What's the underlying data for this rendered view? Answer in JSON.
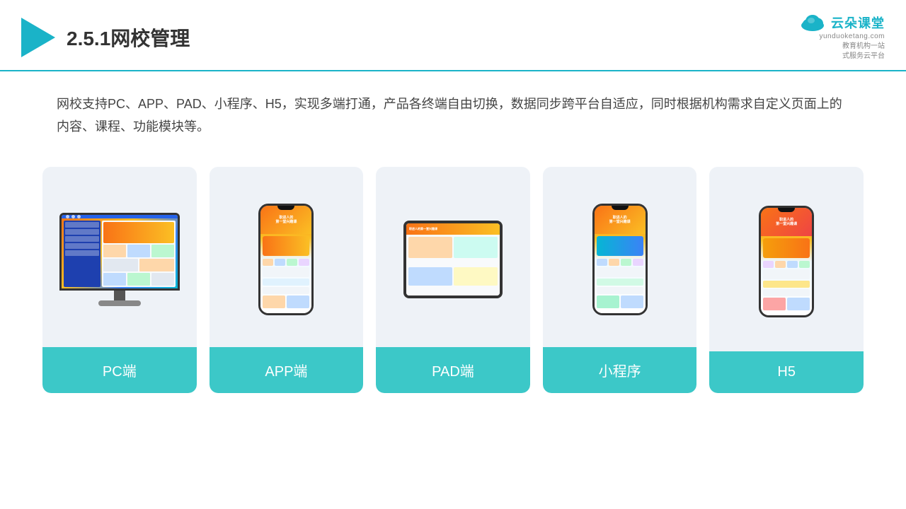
{
  "header": {
    "title": "2.5.1网校管理",
    "brand": {
      "name_cn": "云朵课堂",
      "name_en": "yunduoketang.com",
      "tagline": "教育机构一站\n式服务云平台"
    }
  },
  "description": {
    "text": "网校支持PC、APP、PAD、小程序、H5，实现多端打通，产品各终端自由切换，数据同步跨平台自适应，同时根据机构需求自定义页面上的内容、课程、功能模块等。"
  },
  "cards": [
    {
      "id": "pc",
      "label": "PC端"
    },
    {
      "id": "app",
      "label": "APP端"
    },
    {
      "id": "pad",
      "label": "PAD端"
    },
    {
      "id": "miniprogram",
      "label": "小程序"
    },
    {
      "id": "h5",
      "label": "H5"
    }
  ],
  "colors": {
    "accent": "#1ab3c8",
    "card_bg": "#eef2f7",
    "label_bg": "#3cc8c8",
    "label_text": "#ffffff"
  }
}
